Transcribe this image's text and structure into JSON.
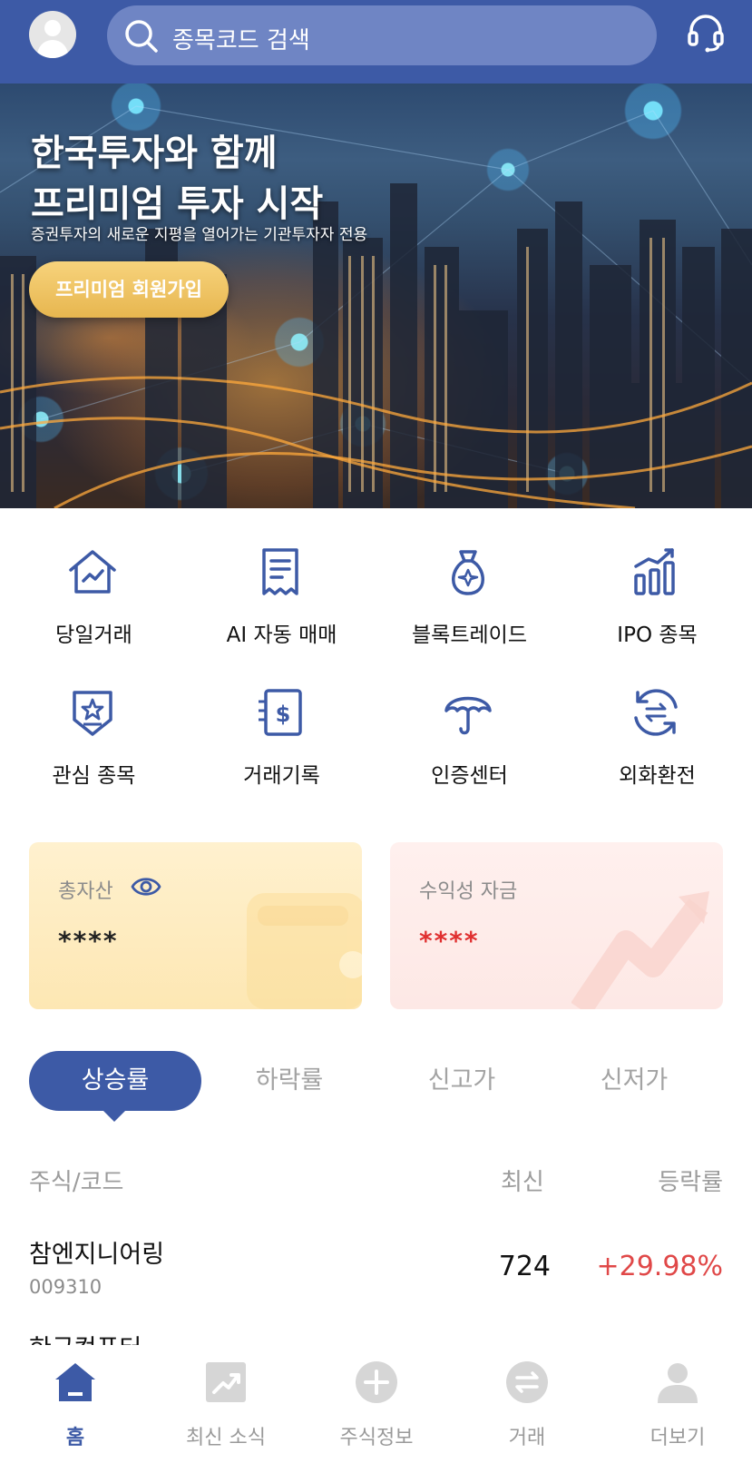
{
  "header": {
    "avatar_icon": "user-avatar-icon",
    "search_placeholder": "종목코드 검색",
    "search_icon": "search-icon",
    "support_icon": "headset-icon"
  },
  "banner": {
    "title_line1": "한국투자와 함께",
    "title_line2": "프리미엄 투자 시작",
    "subtitle": "증권투자의 새로운 지평을 열어가는 기관투자자 전용",
    "cta_label": "프리미엄 회원가입"
  },
  "menu": [
    {
      "label": "당일거래",
      "icon": "house-chart-icon"
    },
    {
      "label": "AI 자동 매매",
      "icon": "receipt-icon"
    },
    {
      "label": "블록트레이드",
      "icon": "money-bag-icon"
    },
    {
      "label": "IPO 종목",
      "icon": "bar-chart-icon"
    },
    {
      "label": "관심 종목",
      "icon": "star-badge-icon"
    },
    {
      "label": "거래기록",
      "icon": "dollar-document-icon"
    },
    {
      "label": "인증센터",
      "icon": "umbrella-icon"
    },
    {
      "label": "외화환전",
      "icon": "exchange-icon"
    }
  ],
  "cards": {
    "total_assets": {
      "label": "총자산",
      "value": "****",
      "icon": "eye-icon"
    },
    "profit_funds": {
      "label": "수익성 자금",
      "value": "****"
    }
  },
  "tabs": [
    {
      "label": "상승률",
      "active": true
    },
    {
      "label": "하락률",
      "active": false
    },
    {
      "label": "신고가",
      "active": false
    },
    {
      "label": "신저가",
      "active": false
    }
  ],
  "table": {
    "headers": {
      "name": "주식/코드",
      "price": "최신",
      "change": "등락률"
    },
    "rows": [
      {
        "name": "참엔지니어링",
        "code": "009310",
        "price": "724",
        "change": "+29.98%"
      },
      {
        "name": "한국컴퓨터",
        "code": "",
        "price": "",
        "change": ""
      }
    ]
  },
  "bottom_nav": [
    {
      "label": "홈",
      "icon": "home-icon",
      "active": true
    },
    {
      "label": "최신 소식",
      "icon": "trend-news-icon",
      "active": false
    },
    {
      "label": "주식정보",
      "icon": "plus-circle-icon",
      "active": false
    },
    {
      "label": "거래",
      "icon": "exchange-circle-icon",
      "active": false
    },
    {
      "label": "더보기",
      "icon": "person-icon",
      "active": false
    }
  ],
  "colors": {
    "brand": "#3d5aa6",
    "positive": "#e04848",
    "gold": "#e7b64f"
  }
}
